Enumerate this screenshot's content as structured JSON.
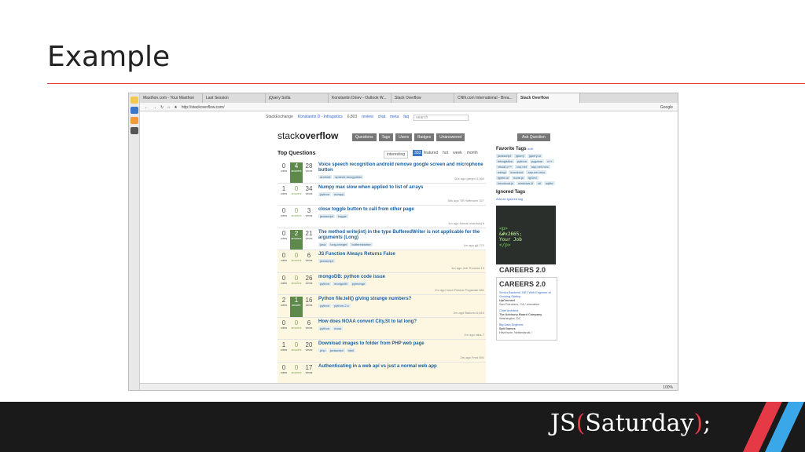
{
  "slide": {
    "title": "Example",
    "brand_prefix": "JS",
    "brand_open": "(",
    "brand_word": "Saturday",
    "brand_close": ")",
    "brand_suffix": ";"
  },
  "browser": {
    "tabs": [
      "Maxthon.com - Your Maxthon",
      "Last Session",
      "jQuery Sofia",
      "Konstantin Dinev - Outlook W...",
      "Stack Overflow",
      "CNN.com International - Brea...",
      "Stack Overflow"
    ],
    "url": "http://stackoverflow.com/",
    "search_placeholder": "Google",
    "zoom": "100%"
  },
  "se_bar": {
    "brand": "StackExchange",
    "user": "Konstantin D - Infragistics",
    "rep": "6,803",
    "links": [
      "review",
      "chat",
      "meta",
      "faq"
    ],
    "search": "search"
  },
  "so": {
    "logo_light": "stack",
    "logo_bold": "overflow",
    "nav": [
      "Questions",
      "Tags",
      "Users",
      "Badges",
      "Unanswered"
    ],
    "ask": "Ask Question",
    "top_questions": "Top Questions",
    "qtabs": [
      "interesting",
      "featured",
      "hot",
      "week",
      "month"
    ],
    "featured_count": "333"
  },
  "questions": [
    {
      "votes": "0",
      "answers": "4",
      "views": "28",
      "accepted": true,
      "hl": false,
      "title": "Voice speech recognition android remove google screen and microphone button",
      "tags": [
        "android",
        "speech-recognition"
      ],
      "meta": "50s ago gregm 4,064"
    },
    {
      "votes": "1",
      "answers": "0",
      "views": "34",
      "accepted": false,
      "hl": false,
      "title": "Numpy max slow when applied to list of arrays",
      "tags": [
        "python",
        "numpy"
      ],
      "meta": "56s ago Till Hoffmann 327"
    },
    {
      "votes": "0",
      "answers": "0",
      "views": "3",
      "accepted": false,
      "hl": false,
      "title": "close toggle button to call from other page",
      "tags": [
        "javascript",
        "toggle"
      ],
      "meta": "1m ago kamal bhardwaj 6"
    },
    {
      "votes": "0",
      "answers": "2",
      "views": "21",
      "accepted": true,
      "hl": false,
      "title": "The method write(int) in the type BufferedWriter is not applicable for the arguments (Long)",
      "tags": [
        "java",
        "long-integer",
        "bufferedwriter"
      ],
      "meta": "1m ago gjt 270"
    },
    {
      "votes": "0",
      "answers": "0",
      "views": "6",
      "accepted": false,
      "hl": true,
      "title": "JS Function Always Returns False",
      "tags": [
        "javascript"
      ],
      "meta": "1m ago Jeb Thomas 13"
    },
    {
      "votes": "0",
      "answers": "0",
      "views": "26",
      "accepted": false,
      "hl": true,
      "title": "mongoDB: python code issue",
      "tags": [
        "python",
        "mongodb",
        "pymongo"
      ],
      "meta": "2m ago Ionut Flavius Pogacian 681"
    },
    {
      "votes": "2",
      "answers": "1",
      "views": "16",
      "accepted": true,
      "hl": true,
      "title": "Python file.tell() giving strange numbers?",
      "tags": [
        "python",
        "python-2.x"
      ],
      "meta": "2m ago Bakuriu 6,610"
    },
    {
      "votes": "0",
      "answers": "0",
      "views": "6",
      "accepted": false,
      "hl": true,
      "title": "How does NOAA convert City,St to lat long?",
      "tags": [
        "python",
        "noaa"
      ],
      "meta": "2m ago rabs 7"
    },
    {
      "votes": "1",
      "answers": "0",
      "views": "20",
      "accepted": false,
      "hl": true,
      "title": "Download images to folder from PHP web page",
      "tags": [
        "php",
        "javascript",
        "html"
      ],
      "meta": "2m ago Fred 591"
    },
    {
      "votes": "0",
      "answers": "0",
      "views": "17",
      "accepted": false,
      "hl": true,
      "title": "Authenticating in a web api vs just a normal web app",
      "tags": [],
      "meta": ""
    }
  ],
  "labels": {
    "votes": "votes",
    "answers": "answers",
    "answer": "answer",
    "views": "views"
  },
  "sidebar": {
    "favorite_title": "Favorite Tags",
    "favorite_edit": "edit",
    "favorite_tags": [
      "javascript",
      "jquery",
      "jquery-ui",
      "infragistics",
      "python",
      "pygame",
      "c++",
      "visual-c++",
      "css.net",
      "asp.net-mvc",
      "webgl",
      "knockout",
      "asp.net-mvc",
      "ignite-ui",
      "node.js",
      "igGrid",
      "knockout.js",
      "windows-8",
      "c#",
      "sqlite"
    ],
    "ignored_title": "Ignored Tags",
    "ignored_link": "Add an ignored tag",
    "code_lines": [
      "<p>",
      "&#x2665;",
      "Your Job",
      "</p>"
    ],
    "careers_label": "CAREERS 2.0",
    "jobs": [
      {
        "title": "Senior Backend .NET Web Engineer at Growing Startup",
        "company": "UpCounsel",
        "loc": "San Francisco, CA / relocation"
      },
      {
        "title": "Chief Architect",
        "company": "The Advisory Board Company",
        "loc": "Washington, DC"
      },
      {
        "title": "Big Data Engineer",
        "company": "Spil Games",
        "loc": "Hilversum, Netherlands /"
      }
    ]
  }
}
